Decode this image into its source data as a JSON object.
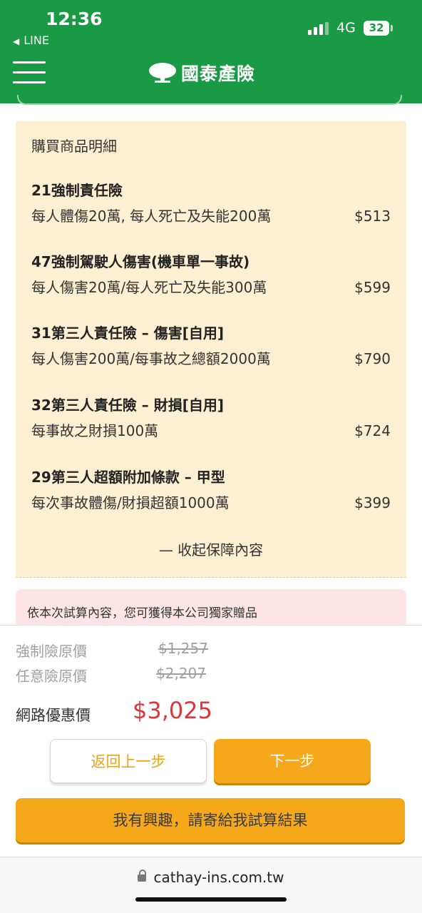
{
  "status_bar": {
    "time": "12:36",
    "back_app": "LINE",
    "network": "4G",
    "battery": "32"
  },
  "header": {
    "logo_text": "國泰產險",
    "brand_color": "#1a9a44"
  },
  "details": {
    "title": "購買商品明細",
    "items": [
      {
        "name": "21強制責任險",
        "coverage": "每人體傷20萬, 每人死亡及失能200萬",
        "price": "$513"
      },
      {
        "name": "47強制駕駛人傷害(機車單一事故)",
        "coverage": "每人傷害20萬/每人死亡及失能300萬",
        "price": "$599"
      },
      {
        "name": "31第三人責任險 – 傷害[自用]",
        "coverage": "每人傷害200萬/每事故之總額2000萬",
        "price": "$790"
      },
      {
        "name": "32第三人責任險 – 財損[自用]",
        "coverage": "每事故之財損100萬",
        "price": "$724"
      },
      {
        "name": "29第三人超額附加條款 – 甲型",
        "coverage": "每次事故體傷/財損超額1000萬",
        "price": "$399"
      }
    ],
    "collapse_label": "— 收起保障內容"
  },
  "gift_notice": "依本次試算內容，您可獲得本公司獨家贈品",
  "pricing": {
    "compulsory_label": "強制險原價",
    "compulsory_price": "$1,257",
    "voluntary_label": "任意險原價",
    "voluntary_price": "$2,207",
    "online_label": "網路優惠價",
    "online_price": "$3,025",
    "accent_color": "#e0343a"
  },
  "buttons": {
    "back": "返回上一步",
    "next": "下一步",
    "interest": "我有興趣，請寄給我試算結果"
  },
  "browser": {
    "url": "cathay-ins.com.tw"
  }
}
